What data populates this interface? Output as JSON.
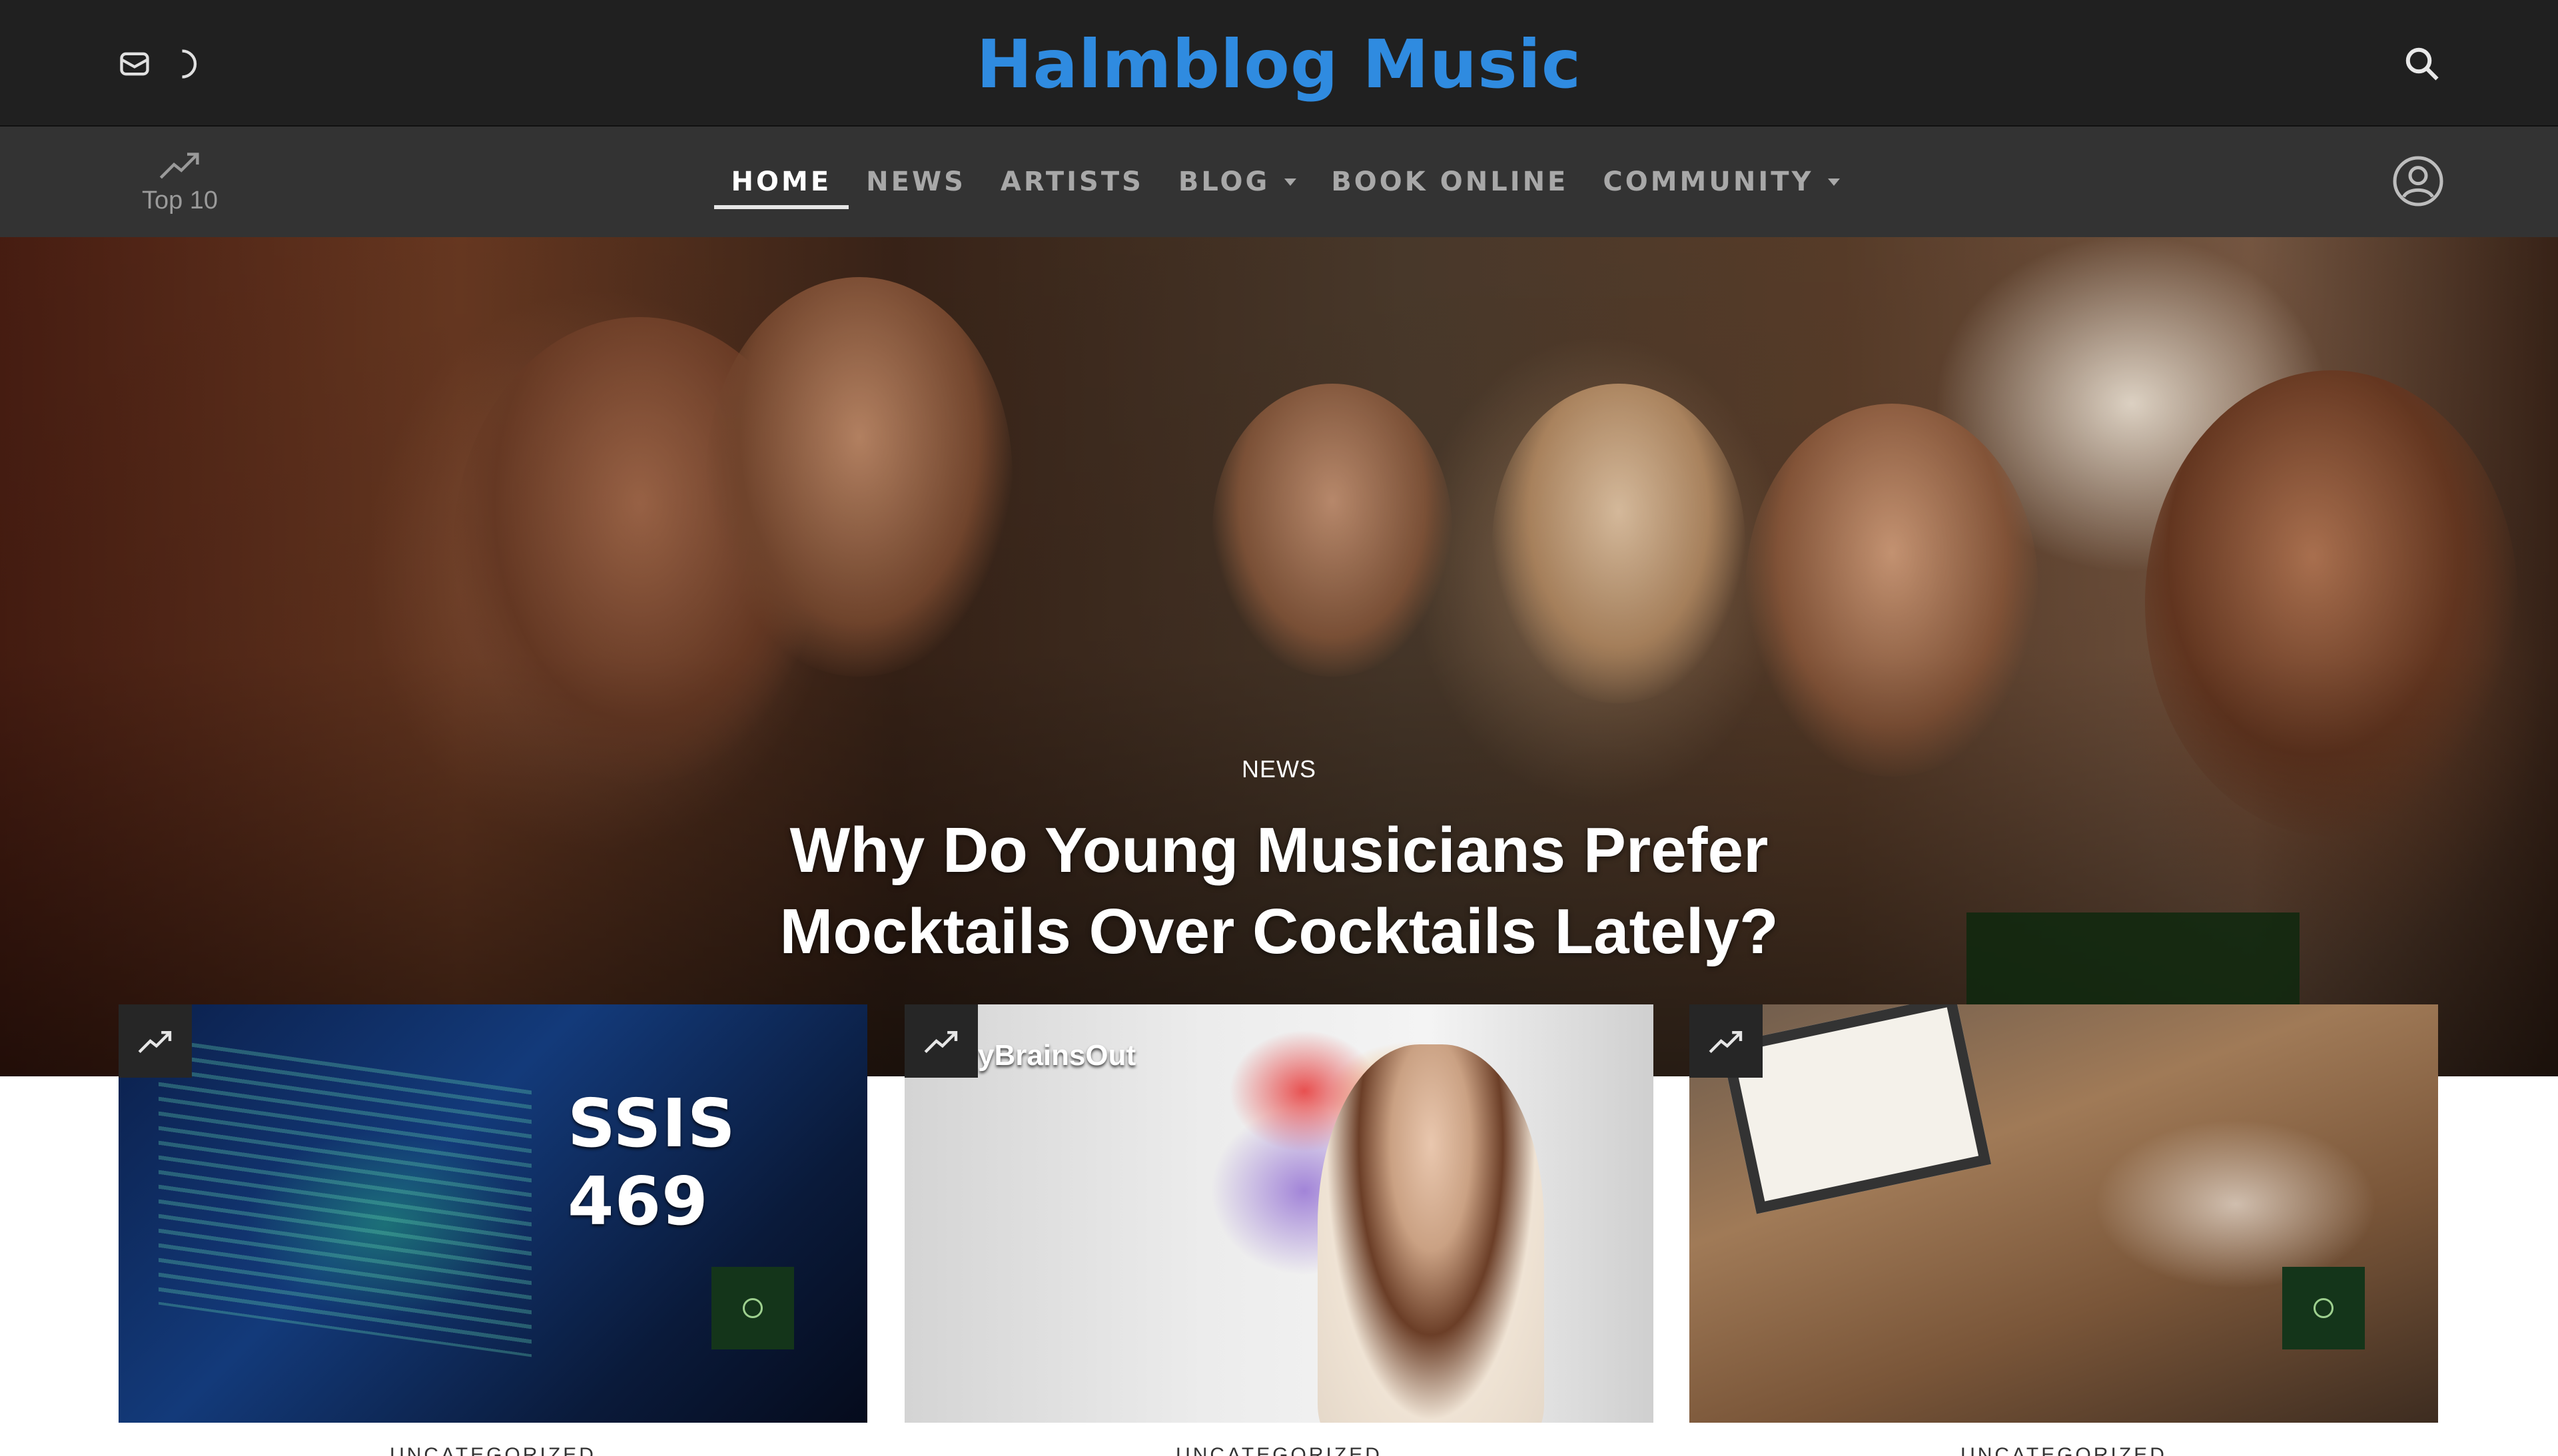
{
  "header": {
    "site_title": "Halmblog Music",
    "title_color": "#2f8be0",
    "left_icons": [
      "mail-icon",
      "moon-icon"
    ],
    "right_icon": "search-icon"
  },
  "nav": {
    "top10_label": "Top 10",
    "top10_icon": "trending-up-icon",
    "items": [
      {
        "label": "HOME",
        "active": true
      },
      {
        "label": "NEWS"
      },
      {
        "label": "ARTISTS"
      },
      {
        "label": "BLOG",
        "has_dropdown": true
      },
      {
        "label": "BOOK ONLINE"
      },
      {
        "label": "COMMUNITY",
        "has_dropdown": true
      }
    ],
    "user_icon": "user-icon"
  },
  "hero": {
    "category": "NEWS",
    "title": "Why Do Young Musicians Prefer Mocktails Over Cocktails Lately?"
  },
  "cards": [
    {
      "image_text": "SSIS 469",
      "badge_icon": "trending-up-icon",
      "category": "UNCATEGORIZED"
    },
    {
      "image_text": "yBrainsOut",
      "badge_icon": "trending-up-icon",
      "category": "UNCATEGORIZED"
    },
    {
      "image_text": "",
      "badge_icon": "trending-up-icon",
      "category": "UNCATEGORIZED"
    }
  ]
}
